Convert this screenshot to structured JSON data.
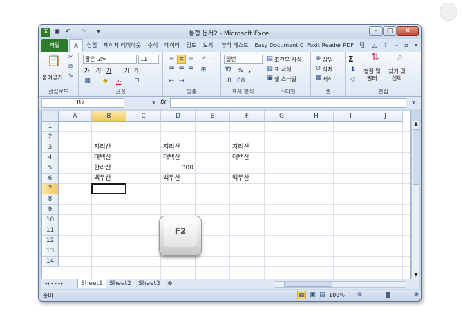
{
  "window": {
    "title": "통합 문서2 - Microsoft Excel"
  },
  "tabs": [
    "파일",
    "홈",
    "삽입",
    "페이지 레이아웃",
    "수식",
    "데이터",
    "검토",
    "보기",
    "부하 테스트",
    "Easy Document C",
    "Foxit Reader PDF",
    "팀"
  ],
  "ribbon": {
    "clipboard": {
      "paste_label": "붙여넣기",
      "group_label": "클립보드"
    },
    "font": {
      "font_name": "맑은 고딕",
      "font_size": "11",
      "bold": "가",
      "italic": "가",
      "underline": "가",
      "grow": "가",
      "shrink": "가",
      "color": "가",
      "group_label": "글꼴"
    },
    "alignment": {
      "group_label": "맞춤"
    },
    "number": {
      "format": "일반",
      "percent": "%",
      "comma": ",",
      "group_label": "표시 형식"
    },
    "styles": {
      "conditional": "조건부 서식",
      "table": "표 서식",
      "cell_styles": "셀 스타일",
      "group_label": "스타일"
    },
    "cells": {
      "insert": "삽입",
      "delete": "삭제",
      "format": "서식",
      "group_label": "셀"
    },
    "editing": {
      "sort_filter": "정렬 및\n필터",
      "find_select": "찾기 및\n선택",
      "sum": "Σ",
      "group_label": "편집"
    }
  },
  "formula_bar": {
    "name_box": "B7",
    "fx": "fx",
    "value": ""
  },
  "grid": {
    "columns": [
      "A",
      "B",
      "C",
      "D",
      "E",
      "F",
      "G",
      "H",
      "I",
      "J"
    ],
    "rows": [
      "1",
      "2",
      "3",
      "4",
      "5",
      "6",
      "7",
      "8",
      "9",
      "10",
      "11",
      "12",
      "13",
      "14"
    ],
    "cells": {
      "B3": "지리산",
      "B4": "태백산",
      "B5": "한라산",
      "B6": "백두산",
      "D3": "지리산",
      "D4": "태백산",
      "D5": "300",
      "D6": "백두산",
      "F3": "지리산",
      "F4": "태백산",
      "F6": "백두산"
    },
    "active_cell": "B7"
  },
  "sheets": [
    "Sheet1",
    "Sheet2",
    "Sheet3"
  ],
  "status": {
    "ready": "준비",
    "zoom": "100%"
  },
  "overlay": {
    "key_label": "F2"
  }
}
